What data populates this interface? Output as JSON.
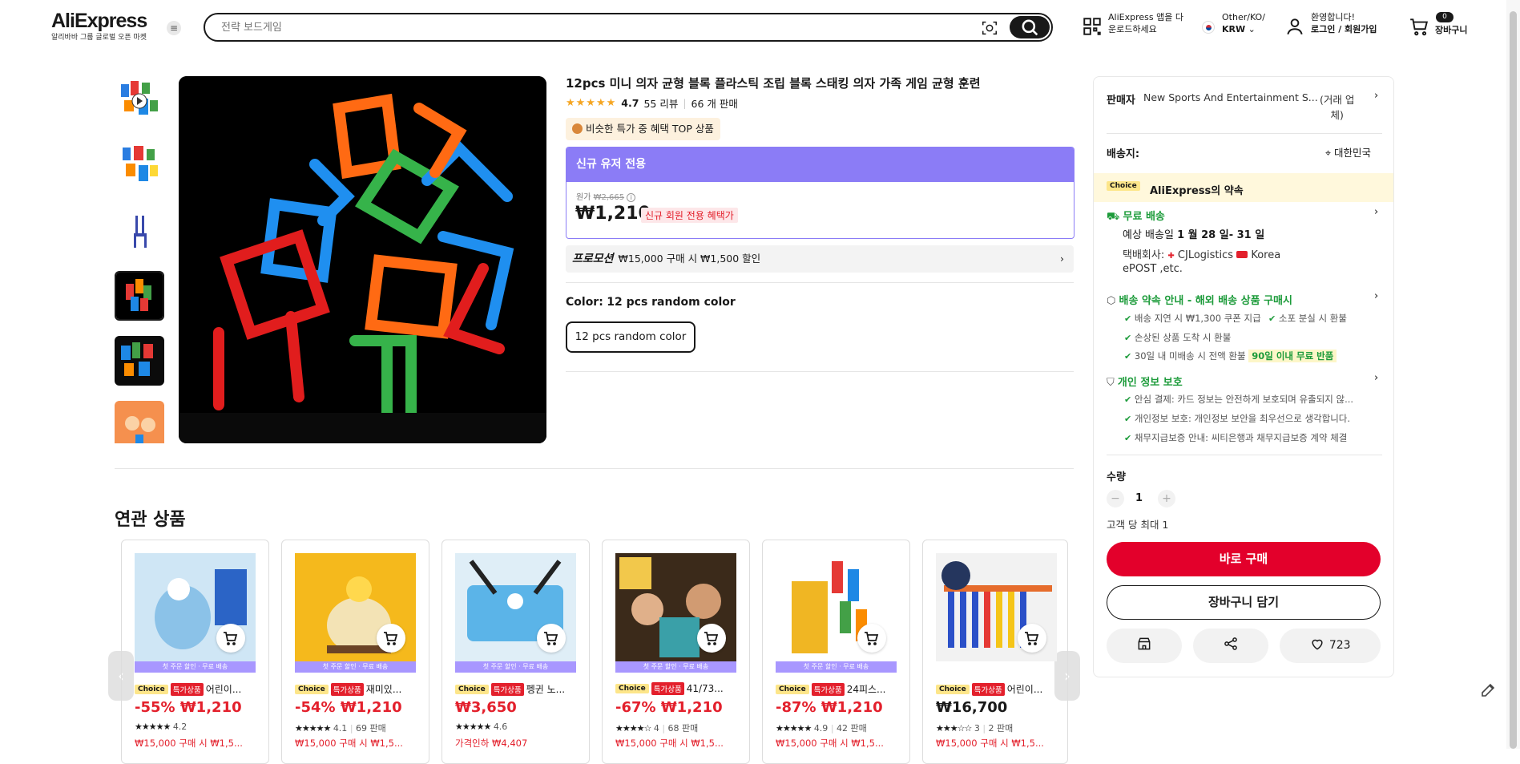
{
  "header": {
    "brand": "AliExpress",
    "tagline": "알리바바 그룹 글로벌 오픈 마켓",
    "search_placeholder": "전략 보드게임",
    "app_line1": "AliExpress 앱을 다",
    "app_line2": "운로드하세요",
    "region_line1": "Other/KO/",
    "region_line2": "KRW",
    "account_line1": "환영합니다!",
    "account_line2": "로그인 / 회원가입",
    "cart_count": "0",
    "cart_label": "장바구니"
  },
  "product": {
    "title": "12pcs 미니 의자 균형 블록 플라스틱 조립 블록 스태킹 의자 가족 게임 균형 훈련",
    "stars": "★★★★★",
    "rating": "4.7",
    "reviews": "55 리뷰",
    "sold": "66 개 판매",
    "choice_top": "비슷한 특가 중 혜택 TOP 상품",
    "new_user_header": "신규 유저 전용",
    "orig_label": "원가",
    "orig_price": "₩2,665",
    "price": "₩1,210",
    "new_user_badge": "신규 회원 전용 혜택가",
    "promo_label": "프로모션",
    "promo_text": "₩15,000 구매 시 ₩1,500 할인",
    "color_label": "Color:",
    "color_value": "12 pcs random color",
    "color_option": "12 pcs random color"
  },
  "related": {
    "heading": "연관 상품",
    "band": "첫 주문 할인 · 무료 배송",
    "choice": "Choice",
    "sale": "특가상품",
    "cards": [
      {
        "title": "어린이...",
        "price": "-55% ₩1,210",
        "stars": "★★★★★",
        "rating": "4.2",
        "sold": "",
        "promo": "₩15,000 구매 시 ₩1,5..."
      },
      {
        "title": "재미있...",
        "price": "-54% ₩1,210",
        "stars": "★★★★★",
        "rating": "4.1",
        "sold": "69 판매",
        "promo": "₩15,000 구매 시 ₩1,5..."
      },
      {
        "title": "펭귄 노...",
        "price": "₩3,650",
        "stars": "★★★★★",
        "rating": "4.6",
        "sold": "",
        "promo": "가격인하 ₩4,407"
      },
      {
        "title": "41/73...",
        "price": "-67% ₩1,210",
        "stars": "★★★★☆",
        "rating": "4",
        "sold": "68 판매",
        "promo": "₩15,000 구매 시 ₩1,5..."
      },
      {
        "title": "24피스...",
        "price": "-87% ₩1,210",
        "stars": "★★★★★",
        "rating": "4.9",
        "sold": "42 판매",
        "promo": "₩15,000 구매 시 ₩1,5..."
      },
      {
        "title": "어린이...",
        "price": "₩16,700",
        "stars": "★★★☆☆",
        "rating": "3",
        "sold": "2 판매",
        "promo": "₩15,000 구매 시 ₩1,5..."
      }
    ]
  },
  "sidebar": {
    "seller_label": "판매자",
    "seller_name": "New Sports And Entertainment S...",
    "seller_type_1": "(거래 업",
    "seller_type_2": "체)",
    "ship_label": "배송지:",
    "ship_to": "대한민국",
    "choice_chip": "Choice",
    "promise": "AliExpress의 약속",
    "free_ship": "무료 배송",
    "eta_label": "예상 배송일",
    "eta_dates": "1 월 28 일- 31 일",
    "carrier_label": "택배회사:",
    "carrier_1": "CJLogistics",
    "carrier_2": "Korea",
    "carrier_3": "ePOST ,etc.",
    "delivery_title": "배송 약속 안내 - 해외 배송 상품 구매시",
    "delivery_items": [
      "배송 지연 시 ₩1,300 쿠폰 지급",
      "소포 분실 시 환불",
      "손상된 상품 도착 시 환불",
      "30일 내 미배송 시 전액 환불"
    ],
    "return_badge": "90일 이내 무료 반품",
    "privacy_title": "개인 정보 보호",
    "privacy_items": [
      "안심 결제: 카드 정보는 안전하게 보호되며 유출되지 않...",
      "개인정보 보호: 개인정보 보안을 최우선으로 생각합니다.",
      "채무지급보증 안내: 씨티은행과 채무지급보증 계약 체결"
    ],
    "qty_label": "수량",
    "qty_minus": "−",
    "qty_value": "1",
    "qty_plus": "+",
    "qty_limit": "고객 당 최대 1",
    "buy_now": "바로 구매",
    "add_cart": "장바구니 담기",
    "wish_count": "723"
  }
}
